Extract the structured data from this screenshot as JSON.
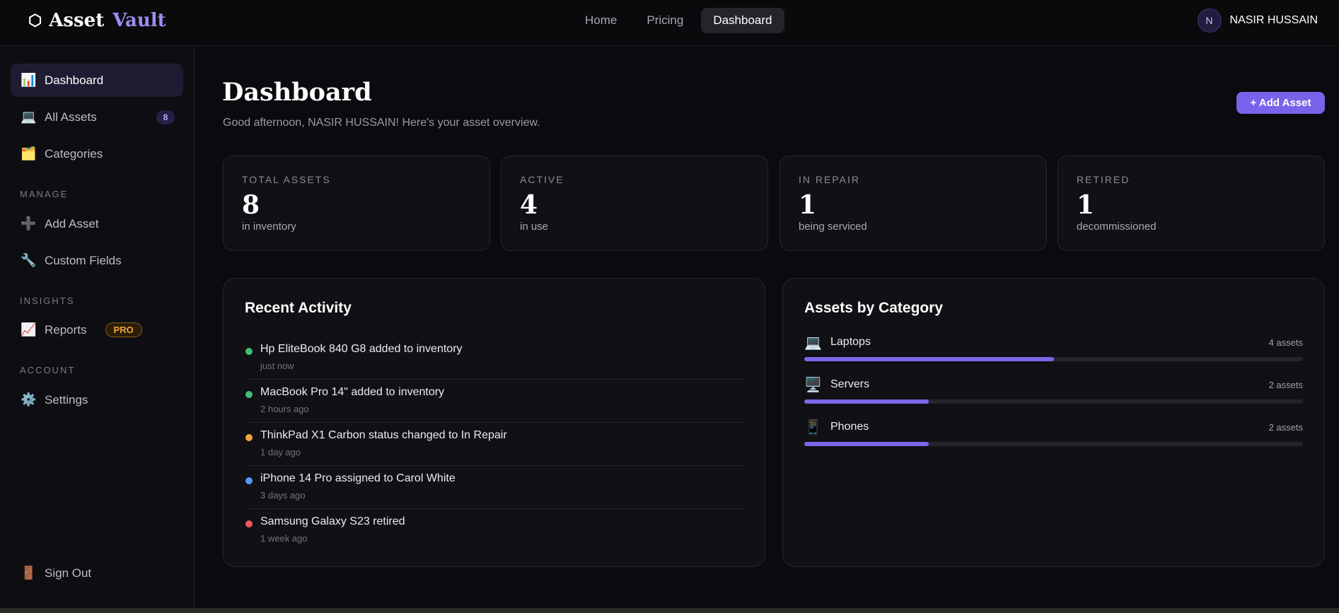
{
  "brand": {
    "icon": "hexagon-icon",
    "word1": "Asset",
    "word2": "Vault"
  },
  "topnav": [
    {
      "label": "Home",
      "active": false
    },
    {
      "label": "Pricing",
      "active": false
    },
    {
      "label": "Dashboard",
      "active": true
    }
  ],
  "user": {
    "initial": "N",
    "name": "NASIR HUSSAIN"
  },
  "sidebar": {
    "items": [
      {
        "label": "Dashboard",
        "icon": "bar-chart-icon",
        "glyph": "📊"
      },
      {
        "label": "All Assets",
        "icon": "laptop-icon",
        "glyph": "💻",
        "badge": "8"
      },
      {
        "label": "Categories",
        "icon": "folder-icon",
        "glyph": "🗂️"
      }
    ],
    "sections": {
      "manage": "MANAGE",
      "insights": "INSIGHTS",
      "account": "ACCOUNT"
    },
    "manage_items": [
      {
        "label": "Add Asset",
        "icon": "plus-icon",
        "glyph": "➕"
      },
      {
        "label": "Custom Fields",
        "icon": "wrench-icon",
        "glyph": "🔧"
      }
    ],
    "insights_items": [
      {
        "label": "Reports",
        "icon": "chart-up-icon",
        "glyph": "📈",
        "badge": "PRO"
      }
    ],
    "account_items": [
      {
        "label": "Settings",
        "icon": "gear-icon",
        "glyph": "⚙️"
      }
    ],
    "sign_out": {
      "label": "Sign Out",
      "icon": "door-icon",
      "glyph": "🚪"
    }
  },
  "main": {
    "title": "Dashboard",
    "greeting": "Good afternoon, NASIR HUSSAIN! Here's your asset overview.",
    "add_button": "+ Add Asset",
    "stats": [
      {
        "label": "TOTAL ASSETS",
        "value": "8",
        "sub": "in inventory"
      },
      {
        "label": "ACTIVE",
        "value": "4",
        "sub": "in use"
      },
      {
        "label": "IN REPAIR",
        "value": "1",
        "sub": "being serviced"
      },
      {
        "label": "RETIRED",
        "value": "1",
        "sub": "decommissioned"
      }
    ],
    "recent_activity": {
      "title": "Recent Activity",
      "items": [
        {
          "text": "Hp EliteBook 840 G8 added to inventory",
          "time": "just now",
          "color": "#3fbf72"
        },
        {
          "text": "MacBook Pro 14\" added to inventory",
          "time": "2 hours ago",
          "color": "#3fbf72"
        },
        {
          "text": "ThinkPad X1 Carbon status changed to In Repair",
          "time": "1 day ago",
          "color": "#f0a63c"
        },
        {
          "text": "iPhone 14 Pro assigned to Carol White",
          "time": "3 days ago",
          "color": "#4f9cf0"
        },
        {
          "text": "Samsung Galaxy S23 retired",
          "time": "1 week ago",
          "color": "#ef5a5a"
        }
      ]
    },
    "assets_by_category": {
      "title": "Assets by Category",
      "items": [
        {
          "name": "Laptops",
          "count": "4 assets",
          "icon": "laptop-icon",
          "glyph": "💻",
          "fraction": 0.5
        },
        {
          "name": "Servers",
          "count": "2 assets",
          "icon": "desktop-icon",
          "glyph": "🖥️",
          "fraction": 0.25
        },
        {
          "name": "Phones",
          "count": "2 assets",
          "icon": "phone-icon",
          "glyph": "📱",
          "fraction": 0.25
        }
      ]
    }
  }
}
